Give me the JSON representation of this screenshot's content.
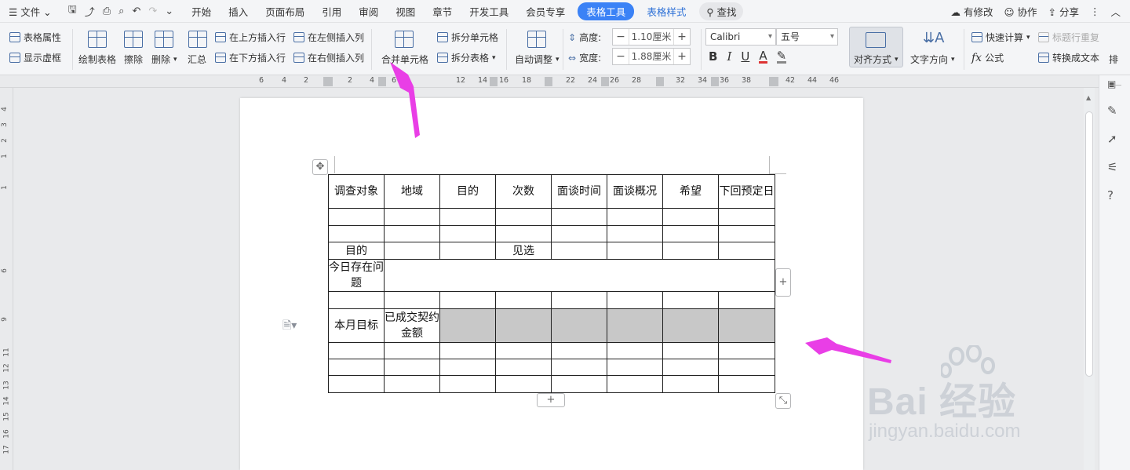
{
  "menubar": {
    "file": "文件",
    "tabs": [
      "开始",
      "插入",
      "页面布局",
      "引用",
      "审阅",
      "视图",
      "章节",
      "开发工具",
      "会员专享"
    ],
    "active_tab": "表格工具",
    "style_tab": "表格样式",
    "search": "查找",
    "modified": "有修改",
    "collab": "协作",
    "share": "分享"
  },
  "ribbon": {
    "table_props": "表格属性",
    "show_grid": "显示虚框",
    "draw_table": "绘制表格",
    "erase": "擦除",
    "delete": "删除",
    "summary": "汇总",
    "insert_row_above": "在上方插入行",
    "insert_row_below": "在下方插入行",
    "insert_col_left": "在左侧插入列",
    "insert_col_right": "在右侧插入列",
    "merge_cells": "合并单元格",
    "split_cells": "拆分单元格",
    "split_table": "拆分表格",
    "auto_adjust": "自动调整",
    "height_label": "高度:",
    "height_value": "1.10厘米",
    "width_label": "宽度:",
    "width_value": "1.88厘米",
    "font_name": "Calibri",
    "font_size": "五号",
    "align": "对齐方式",
    "text_dir": "文字方向",
    "quick_calc": "快速计算",
    "repeat_header": "标题行重复",
    "formula": "公式",
    "convert_text": "转换成文本",
    "sort": "排"
  },
  "ruler_h": [
    "6",
    "4",
    "2",
    "2",
    "4",
    "6",
    "12",
    "14",
    "16",
    "18",
    "22",
    "24",
    "26",
    "28",
    "32",
    "34",
    "36",
    "38",
    "42",
    "44",
    "46"
  ],
  "ruler_v": [
    "4",
    "3",
    "2",
    "1",
    "1",
    "6",
    "9",
    "11",
    "12",
    "13",
    "14",
    "15",
    "16",
    "17"
  ],
  "table": {
    "header": [
      "调查对象",
      "地域",
      "目的",
      "次数",
      "面谈时间",
      "面谈概况",
      "希望",
      "下回预定日"
    ],
    "row_purpose": [
      "目的",
      "",
      "",
      "见选",
      "",
      "",
      "",
      ""
    ],
    "issues_label": "今日存在问题",
    "goal_label": "本月目标",
    "goal_amount": "已成交契约金额"
  },
  "watermark": {
    "brand": "Bai  经验",
    "url": "jingyan.baidu.com"
  },
  "colors": {
    "accent": "#3b82f6",
    "arrow": "#e93ee6",
    "shade": "#c8c8c8"
  }
}
